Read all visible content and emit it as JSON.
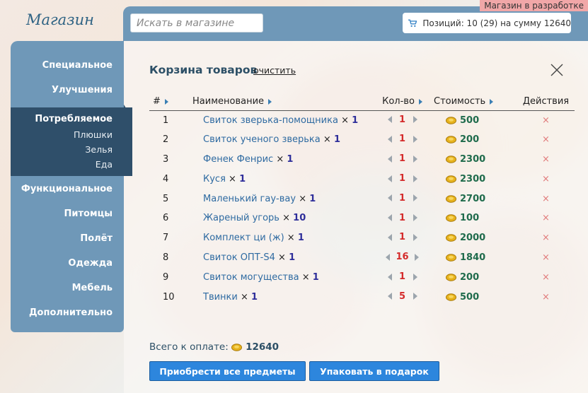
{
  "app": {
    "logo": "Магазин",
    "dev_badge": "Магазин в разработке"
  },
  "search": {
    "placeholder": "Искать в магазине"
  },
  "cart_summary": {
    "text": "Позиций: 10 (29) на сумму 12640"
  },
  "sidebar": {
    "items": [
      {
        "label": "Специальное"
      },
      {
        "label": "Улучшения"
      },
      {
        "label": "Потребляемое",
        "active": true,
        "children": [
          "Плюшки",
          "Зелья",
          "Еда"
        ]
      },
      {
        "label": "Функциональное"
      },
      {
        "label": "Питомцы"
      },
      {
        "label": "Полёт"
      },
      {
        "label": "Одежда"
      },
      {
        "label": "Мебель"
      },
      {
        "label": "Дополнительно"
      }
    ]
  },
  "cart": {
    "title": "Корзина товаров",
    "clear_label": "очистить",
    "columns": {
      "num": "#",
      "name": "Наименование",
      "qty": "Кол-во",
      "cost": "Стоимость",
      "actions": "Действия"
    },
    "rows": [
      {
        "num": "1",
        "name": "Свиток зверька-помощника",
        "times": "×",
        "count": "1",
        "qty": "1",
        "cost": "500"
      },
      {
        "num": "2",
        "name": "Свиток ученого зверька",
        "times": "×",
        "count": "1",
        "qty": "1",
        "cost": "200"
      },
      {
        "num": "3",
        "name": "Фенек Фенрис",
        "times": "×",
        "count": "1",
        "qty": "1",
        "cost": "2300"
      },
      {
        "num": "4",
        "name": "Куся",
        "times": "×",
        "count": "1",
        "qty": "1",
        "cost": "2300"
      },
      {
        "num": "5",
        "name": "Маленький гау-вау",
        "times": "×",
        "count": "1",
        "qty": "1",
        "cost": "2700"
      },
      {
        "num": "6",
        "name": "Жареный угорь",
        "times": "×",
        "count": "10",
        "qty": "1",
        "cost": "100"
      },
      {
        "num": "7",
        "name": "Комплект ци (ж)",
        "times": "×",
        "count": "1",
        "qty": "1",
        "cost": "2000"
      },
      {
        "num": "8",
        "name": "Свиток ОПТ-S4",
        "times": "×",
        "count": "1",
        "qty": "16",
        "cost": "1840"
      },
      {
        "num": "9",
        "name": "Свиток могущества",
        "times": "×",
        "count": "1",
        "qty": "1",
        "cost": "200"
      },
      {
        "num": "10",
        "name": "Твинки",
        "times": "×",
        "count": "1",
        "qty": "5",
        "cost": "500"
      }
    ],
    "remove_symbol": "×"
  },
  "total": {
    "label": "Всего к оплате:",
    "value": "12640"
  },
  "buttons": {
    "buy_all": "Приобрести все предметы",
    "gift": "Упаковать в подарок"
  },
  "colors": {
    "panel": "#6f98b8",
    "active_nav": "#2f4f6a",
    "button": "#2d86dd",
    "qty": "#d42b2b",
    "price": "#1f6b4c"
  }
}
